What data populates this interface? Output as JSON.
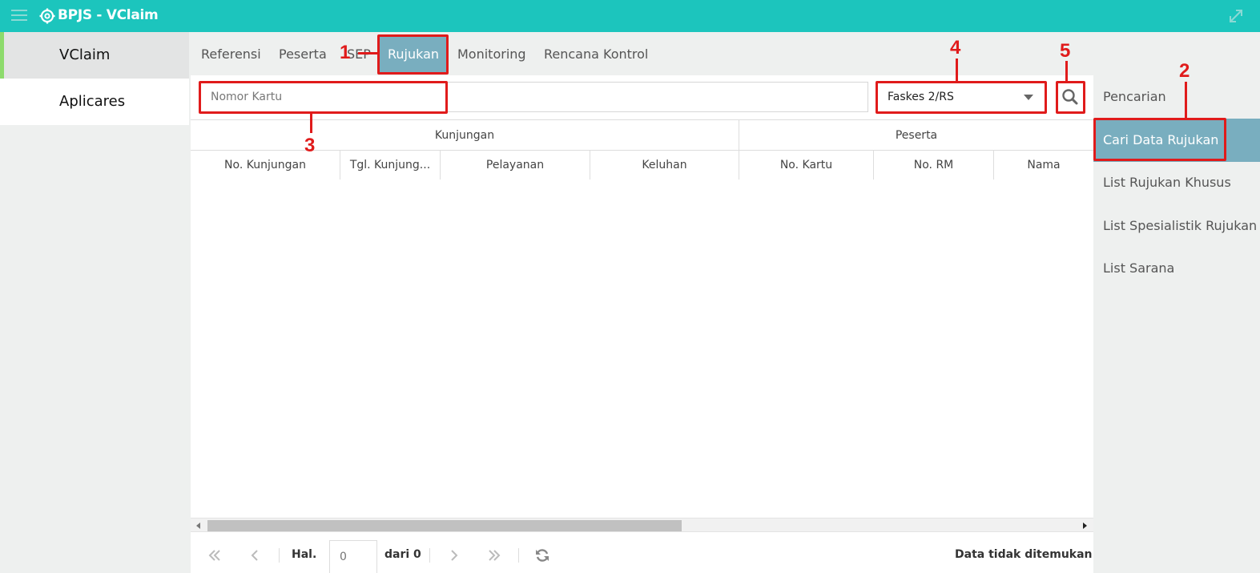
{
  "app": {
    "title": "BPJS - VClaim"
  },
  "left_nav": {
    "items": [
      {
        "label": "VClaim"
      },
      {
        "label": "Aplicares"
      }
    ]
  },
  "tabs": [
    {
      "label": "Referensi"
    },
    {
      "label": "Peserta"
    },
    {
      "label": "SEP"
    },
    {
      "label": "Rujukan"
    },
    {
      "label": "Monitoring"
    },
    {
      "label": "Rencana Kontrol"
    }
  ],
  "search": {
    "placeholder": "Nomor Kartu",
    "value": ""
  },
  "faskes_select": {
    "selected": "Faskes 2/RS"
  },
  "table": {
    "groups": [
      {
        "label": "Kunjungan"
      },
      {
        "label": "Peserta"
      }
    ],
    "columns": [
      {
        "label": "No. Kunjungan"
      },
      {
        "label": "Tgl. Kunjung..."
      },
      {
        "label": "Pelayanan"
      },
      {
        "label": "Keluhan"
      },
      {
        "label": "No. Kartu"
      },
      {
        "label": "No. RM"
      },
      {
        "label": "Nama"
      }
    ],
    "rows": []
  },
  "pager": {
    "page_label": "Hal.",
    "page_value": "0",
    "of_label": "dari 0",
    "status": "Data tidak ditemukan"
  },
  "right_nav": {
    "items": [
      {
        "label": "Pencarian"
      },
      {
        "label": "Cari Data Rujukan"
      },
      {
        "label": "List Rujukan Khusus"
      },
      {
        "label": "List Spesialistik Rujukan"
      },
      {
        "label": "List Sarana"
      }
    ]
  },
  "annotations": [
    {
      "label": "1"
    },
    {
      "label": "2"
    },
    {
      "label": "3"
    },
    {
      "label": "4"
    },
    {
      "label": "5"
    }
  ],
  "colors": {
    "topbar": "#1cc5bd",
    "active_tab": "#79aebf",
    "active_accent": "#8ddb6c",
    "annotation": "#e01b1b"
  },
  "icons": [
    "hamburger-icon",
    "settings-gear-icon",
    "expand-icon",
    "dropdown-arrow-icon",
    "search-icon",
    "first-page-icon",
    "prev-page-icon",
    "next-page-icon",
    "last-page-icon",
    "refresh-icon"
  ]
}
